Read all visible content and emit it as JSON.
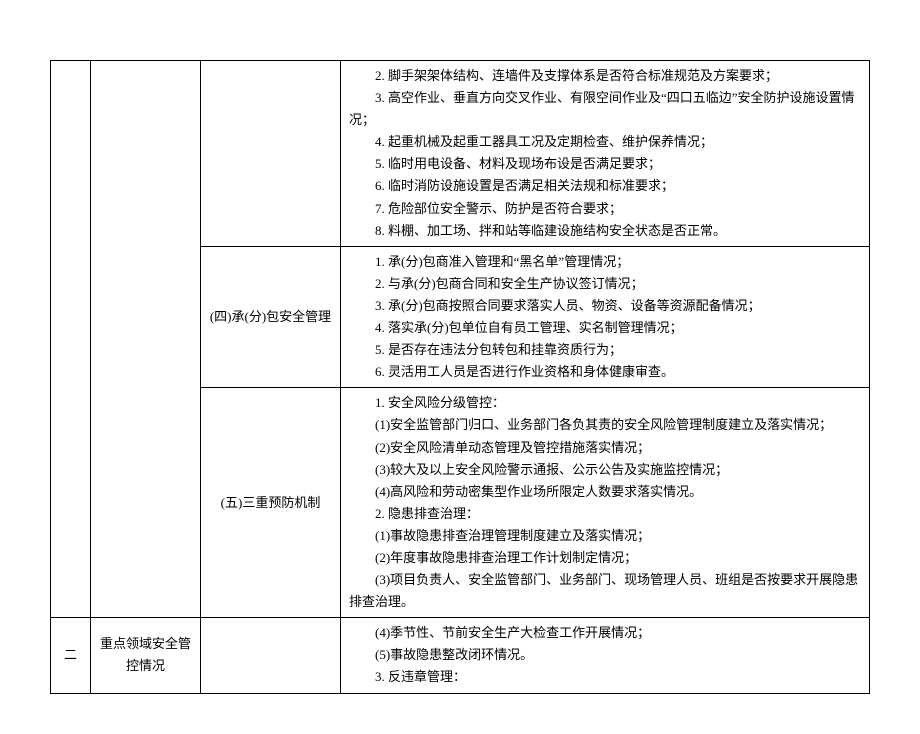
{
  "rows": [
    {
      "col1": "",
      "col2": "",
      "col3": "",
      "lines": [
        "2. 脚手架架体结构、连墙件及支撑体系是否符合标准规范及方案要求；",
        "3. 高空作业、垂直方向交叉作业、有限空间作业及“四口五临边”安全防护设施设置情况；",
        "4. 起重机械及起重工器具工况及定期检查、维护保养情况；",
        "5. 临时用电设备、材料及现场布设是否满足要求；",
        "6. 临时消防设施设置是否满足相关法规和标准要求；",
        "7. 危险部位安全警示、防护是否符合要求；",
        "8. 料棚、加工场、拌和站等临建设施结构安全状态是否正常。"
      ]
    },
    {
      "col3": "(四)承(分)包安全管理",
      "lines": [
        "1. 承(分)包商准入管理和“黑名单”管理情况；",
        "2. 与承(分)包商合同和安全生产协议签订情况；",
        "3. 承(分)包商按照合同要求落实人员、物资、设备等资源配备情况；",
        "4. 落实承(分)包单位自有员工管理、实名制管理情况；",
        "5. 是否存在违法分包转包和挂靠资质行为；",
        "6. 灵活用工人员是否进行作业资格和身体健康审查。"
      ]
    },
    {
      "col3": "(五)三重预防机制",
      "lines": [
        "1. 安全风险分级管控：",
        "(1)安全监管部门归口、业务部门各负其责的安全风险管理制度建立及落实情况；",
        "(2)安全风险清单动态管理及管控措施落实情况；",
        "(3)较大及以上安全风险警示通报、公示公告及实施监控情况；",
        "(4)高风险和劳动密集型作业场所限定人数要求落实情况。",
        "2. 隐患排查治理：",
        "(1)事故隐患排查治理管理制度建立及落实情况；",
        "(2)年度事故隐患排查治理工作计划制定情况；",
        "(3)项目负责人、安全监管部门、业务部门、现场管理人员、班组是否按要求开展隐患排查治理。"
      ]
    },
    {
      "col1": "二",
      "col2": "重点领域安全管控情况",
      "col3": "",
      "lines": [
        "(4)季节性、节前安全生产大检查工作开展情况；",
        "(5)事故隐患整改闭环情况。",
        "3. 反违章管理："
      ]
    }
  ]
}
